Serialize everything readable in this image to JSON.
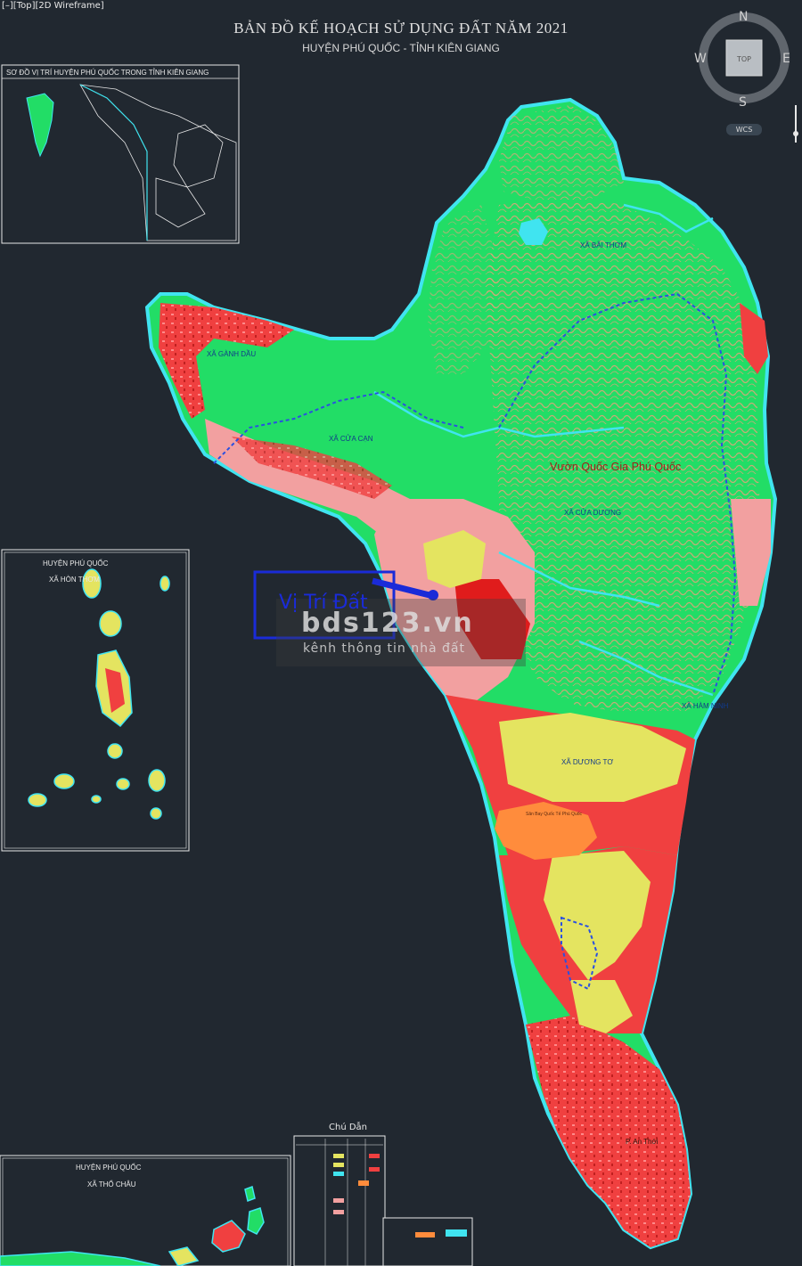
{
  "viewport": {
    "label": "[–][Top][2D Wireframe]"
  },
  "header": {
    "title": "BẢN ĐỒ KẾ HOẠCH SỬ DỤNG ĐẤT NĂM 2021",
    "subtitle": "HUYỆN PHÚ QUỐC - TỈNH KIÊN GIANG"
  },
  "viewcube": {
    "north": "N",
    "south": "S",
    "east": "E",
    "west": "W",
    "face": "TOP",
    "wcs": "WCS"
  },
  "inset_location": {
    "title": "SƠ ĐỒ VỊ TRÍ HUYỆN PHÚ QUỐC TRONG TỈNH KIÊN GIANG"
  },
  "inset_hon_thom": {
    "title_line1": "HUYỆN PHÚ QUỐC",
    "title_line2": "XÃ HÒN THƠM"
  },
  "inset_tho_chau": {
    "title_line1": "HUYỆN PHÚ QUỐC",
    "title_line2": "XÃ THỔ CHÂU"
  },
  "map_labels": {
    "bai_thom": "XÃ BÃI THƠM",
    "ganh_dau": "XÃ GÀNH DẦU",
    "cua_can": "XÃ CỬA CẠN",
    "national_park": "Vườn Quốc Gia Phú Quốc",
    "cua_duong": "XÃ CỬA DƯƠNG",
    "ham_ninh": "XÃ HÀM NINH",
    "duong_to": "XÃ DƯƠNG TƠ",
    "airport": "Sân Bay Quốc Tế Phú Quốc",
    "an_thoi": "P. An Thới"
  },
  "marker": {
    "label": "Vị Trí Đất",
    "color": "#1a2bd8"
  },
  "watermark": {
    "main": "bds123.vn",
    "sub": "kênh thông tin nhà đất"
  },
  "legend": {
    "title": "Chú Dẫn"
  },
  "colors": {
    "background": "#212830",
    "forest": "#26ee66",
    "contour": "#e8a07a",
    "residential": "#f04040",
    "urban": "#f2a0a0",
    "agriculture": "#e4e460",
    "water": "#40e4f0",
    "airport": "#ff8c3c"
  }
}
